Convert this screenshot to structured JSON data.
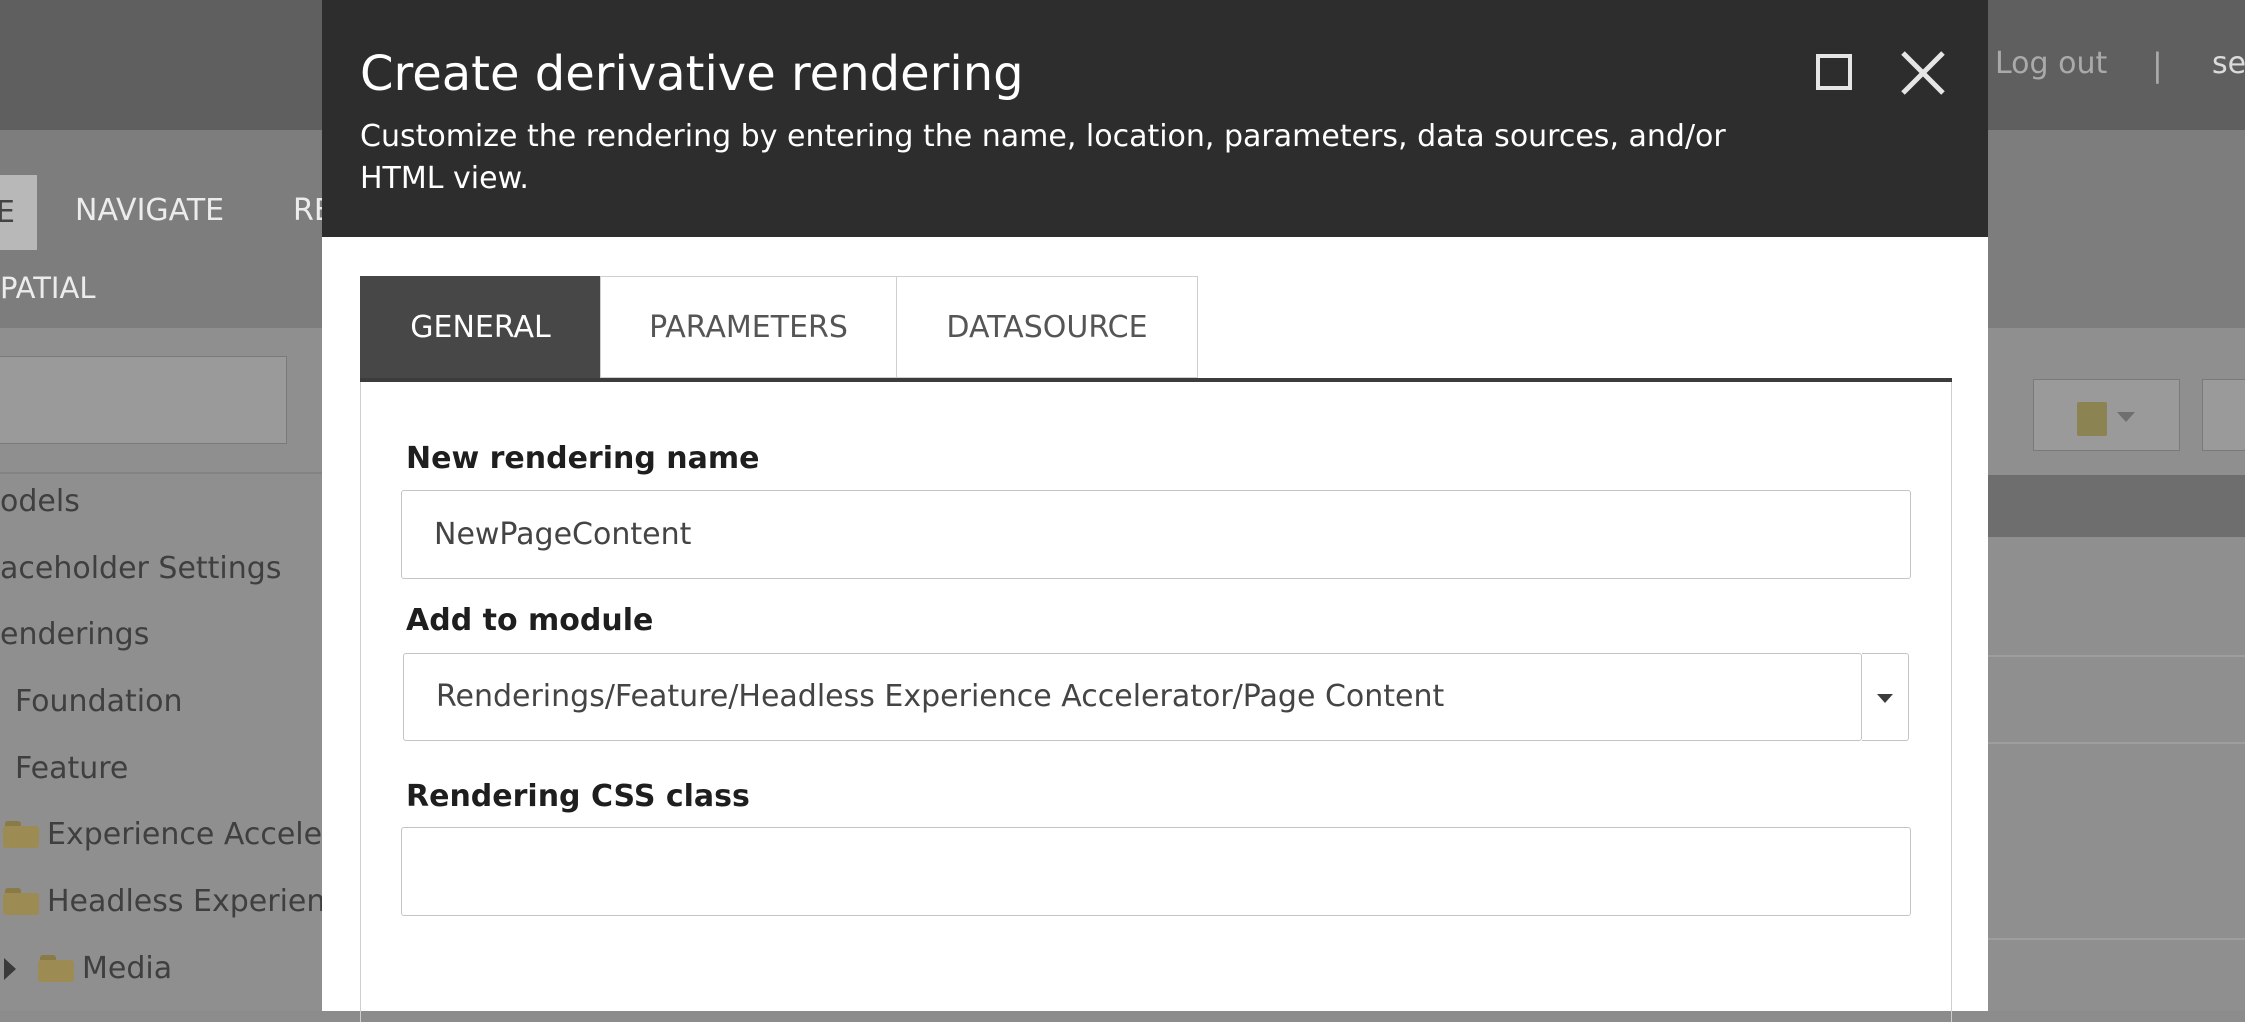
{
  "background_app": {
    "logout_label": "Log out",
    "separator": "|",
    "user_label": "se",
    "active_tab_fragment": "E",
    "ribbon_tabs": [
      "NAVIGATE",
      "RE"
    ],
    "ribbon_subtab": "PATIAL",
    "tree_items": [
      {
        "label": "odels"
      },
      {
        "label": "aceholder Settings"
      },
      {
        "label": "enderings"
      },
      {
        "label": "Foundation"
      },
      {
        "label": "Feature"
      },
      {
        "label": "Experience Acceler"
      },
      {
        "label": "Headless Experienc"
      },
      {
        "label": "Media"
      }
    ]
  },
  "dialog": {
    "title": "Create derivative rendering",
    "subtitle": "Customize the rendering by entering the name, location, parameters, data sources, and/or HTML view.",
    "tabs": [
      {
        "label": "GENERAL",
        "active": true
      },
      {
        "label": "PARAMETERS",
        "active": false
      },
      {
        "label": "DATASOURCE",
        "active": false
      }
    ],
    "form": {
      "rendering_name_label": "New rendering name",
      "rendering_name_value": "NewPageContent",
      "module_label": "Add to module",
      "module_value": "Renderings/Feature/Headless Experience Accelerator/Page Content",
      "css_class_label": "Rendering CSS class",
      "css_class_value": ""
    }
  },
  "colors": {
    "dialog_header": "#2d2d2d",
    "active_tab": "#474747",
    "overlay": "#8c8c8c"
  }
}
